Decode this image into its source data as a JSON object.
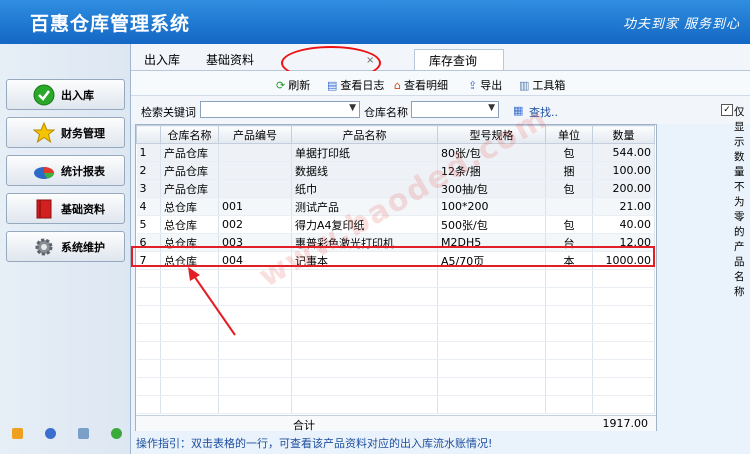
{
  "header": {
    "title": "百惠仓库管理系统",
    "slogan": "功夫到家 服务到心"
  },
  "sidebar": {
    "items": [
      {
        "label": "出入库"
      },
      {
        "label": "财务管理"
      },
      {
        "label": "统计报表"
      },
      {
        "label": "基础资料"
      },
      {
        "label": "系统维护"
      }
    ]
  },
  "tabs": [
    {
      "label": "出入库"
    },
    {
      "label": "基础资料"
    },
    {
      "label": "库存查询"
    }
  ],
  "toolbar": {
    "refresh": "刷新",
    "view_log": "查看日志",
    "view_detail": "查看明细",
    "export": "导出",
    "toolbox": "工具箱"
  },
  "search": {
    "keyword_label": "检索关键词",
    "keyword_value": "",
    "warehouse_label": "仓库名称",
    "warehouse_value": "",
    "find_label": "查找..",
    "checkbox_label": "仅显示数量不为零的产品名称",
    "checkbox_checked": "✓"
  },
  "grid": {
    "columns": [
      "仓库名称",
      "产品编号",
      "产品名称",
      "型号规格",
      "单位",
      "数量"
    ],
    "rows": [
      [
        "1",
        "产品仓库",
        "",
        "单据打印纸",
        "80张/包",
        "包",
        "544.00"
      ],
      [
        "2",
        "产品仓库",
        "",
        "数据线",
        "12条/捆",
        "捆",
        "100.00"
      ],
      [
        "3",
        "产品仓库",
        "",
        "纸巾",
        "300抽/包",
        "包",
        "200.00"
      ],
      [
        "4",
        "总仓库",
        "001",
        "测试产品",
        "100*200",
        "",
        "21.00"
      ],
      [
        "5",
        "总仓库",
        "002",
        "得力A4复印纸",
        "500张/包",
        "包",
        "40.00"
      ],
      [
        "6",
        "总仓库",
        "003",
        "惠普彩色激光打印机",
        "M2DH5",
        "台",
        "12.00"
      ],
      [
        "7",
        "总仓库",
        "004",
        "记事本",
        "A5/70页",
        "本",
        "1000.00"
      ]
    ],
    "total_label": "合计",
    "total_value": "1917.00"
  },
  "hint": "操作指引：双击表格的一行，可查看该产品资料对应的出入库流水账情况!",
  "watermark": "www.baoded.com",
  "colors": {
    "header": "#1f7ad6",
    "highlight": "#e31e24",
    "hint": "#1d4fa0"
  }
}
